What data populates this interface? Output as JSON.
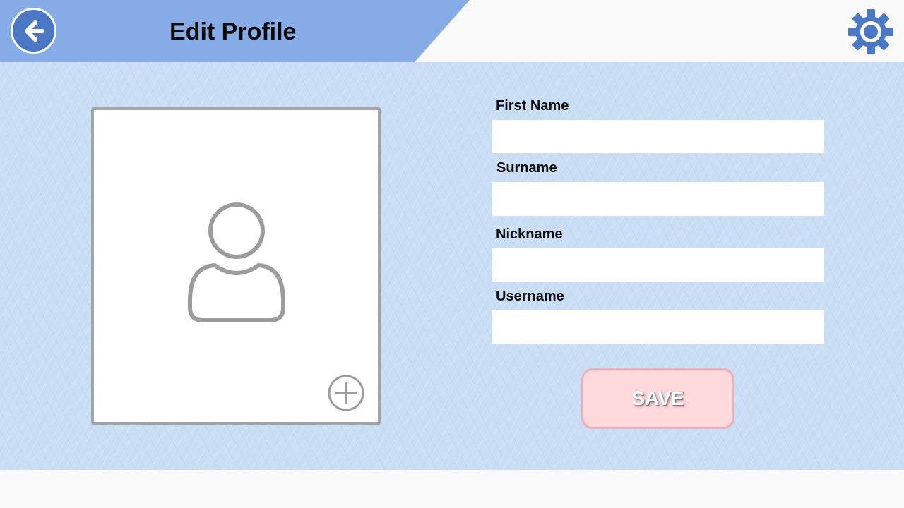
{
  "header": {
    "title": "Edit Profile",
    "back_icon": "arrow-left-icon",
    "settings_icon": "gear-icon"
  },
  "photo": {
    "placeholder_icon": "user-silhouette-icon",
    "add_icon": "plus-circle-icon"
  },
  "form": {
    "fields": [
      {
        "label": "First Name",
        "value": ""
      },
      {
        "label": "Surname",
        "value": ""
      },
      {
        "label": "Nickname",
        "value": ""
      },
      {
        "label": "Username",
        "value": ""
      }
    ],
    "save_label": "SAVE"
  },
  "colors": {
    "header_band": "#86ace8",
    "accent_blue": "#4a78c4",
    "content_bg": "#c9ddf5",
    "save_bg": "#fdd9dc",
    "save_border": "#f1adb3"
  }
}
